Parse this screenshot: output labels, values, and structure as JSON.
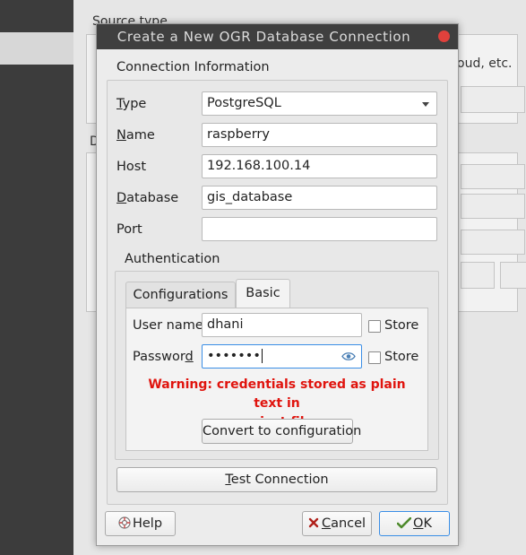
{
  "background": {
    "source_type_label": "Source type",
    "cloud_text": "oud, etc.",
    "d_label": "D"
  },
  "dialog": {
    "title": "Create a New OGR Database Connection",
    "connection_info": {
      "heading": "Connection Information",
      "type": {
        "label_u": "T",
        "label_rest": "ype",
        "value": "PostgreSQL"
      },
      "name": {
        "label_u": "N",
        "label_rest": "ame",
        "value": "raspberry"
      },
      "host": {
        "label": "Host",
        "value": "192.168.100.14"
      },
      "database": {
        "label_u": "D",
        "label_rest": "atabase",
        "value": "gis_database"
      },
      "port": {
        "label": "Port",
        "value": ""
      }
    },
    "authentication": {
      "heading": "Authentication",
      "tabs": [
        {
          "label": "Configurations",
          "active": false
        },
        {
          "label": "Basic",
          "active": true
        }
      ],
      "username": {
        "label": "User name",
        "value": "dhani",
        "store_label": "Store"
      },
      "password": {
        "label_pre": "Passwor",
        "label_u": "d",
        "value": "•••••••",
        "store_label": "Store"
      },
      "warning_line1": "Warning: credentials stored as plain text in",
      "warning_line2": "project file.",
      "convert_button": "Convert to configuration"
    },
    "test_connection": {
      "label_u": "T",
      "label_rest": "est Connection"
    },
    "buttons": {
      "help": "Help",
      "cancel_u": "C",
      "cancel_rest": "ancel",
      "ok_u": "O",
      "ok_rest": "K"
    },
    "colors": {
      "warning": "#e0140e",
      "titlebar": "#3f3f3f",
      "close": "#e0413c"
    }
  }
}
